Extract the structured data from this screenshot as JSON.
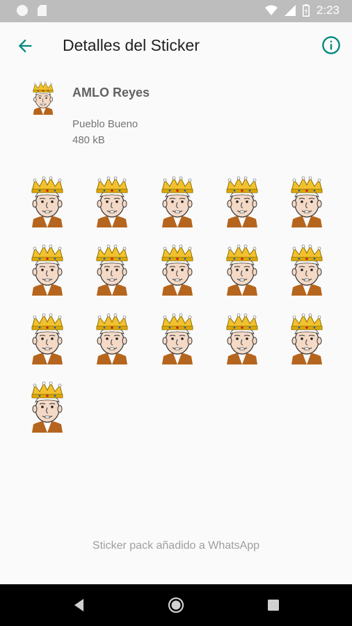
{
  "status": {
    "time": "2:23"
  },
  "header": {
    "title": "Detalles del Sticker"
  },
  "pack": {
    "name": "AMLO Reyes",
    "author": "Pueblo Bueno",
    "size": "480 kB"
  },
  "stickers": [
    "sticker-1",
    "sticker-2",
    "sticker-3",
    "sticker-4",
    "sticker-5",
    "sticker-6",
    "sticker-7",
    "sticker-8",
    "sticker-9",
    "sticker-10",
    "sticker-11",
    "sticker-12",
    "sticker-13",
    "sticker-14",
    "sticker-15",
    "sticker-16"
  ],
  "footer": {
    "message": "Sticker pack añadido a WhatsApp"
  },
  "colors": {
    "accent": "#00897b",
    "status_bar": "#bdbdbd",
    "nav_bar": "#000000",
    "crown": "#f2c12e",
    "skin": "#f3d9c6"
  },
  "icons": {
    "back": "arrow-left-icon",
    "info": "info-icon",
    "nav_back": "nav-back-icon",
    "nav_home": "nav-home-icon",
    "nav_recents": "nav-recents-icon"
  }
}
